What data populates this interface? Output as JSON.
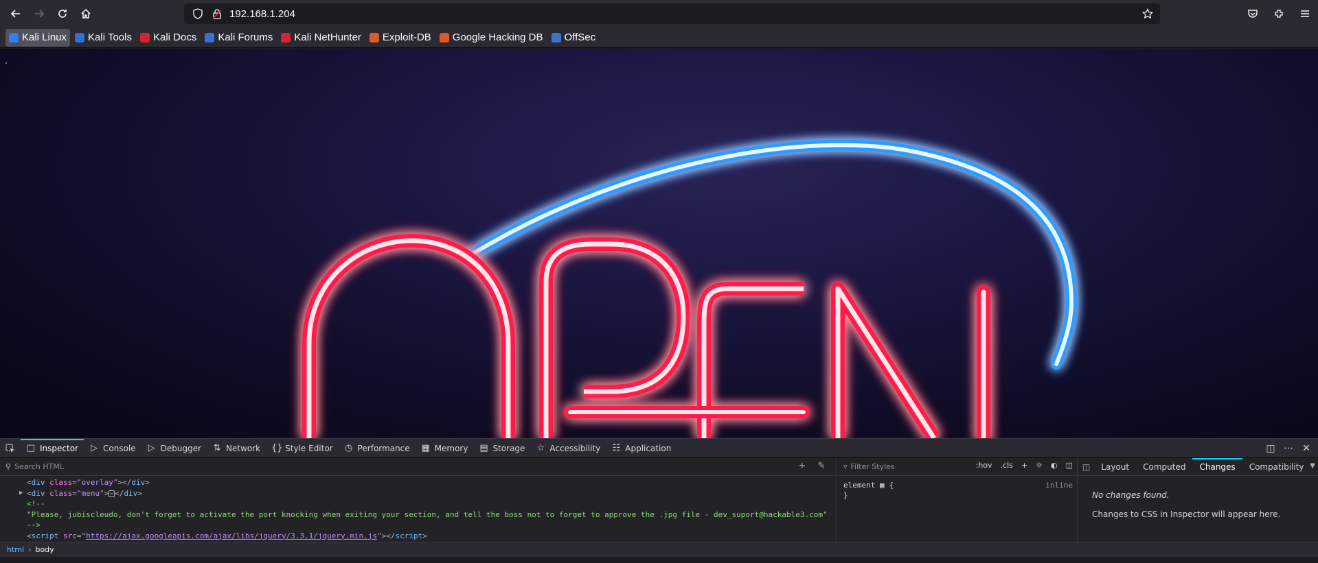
{
  "browser": {
    "url": "192.168.1.204",
    "nav": {
      "back": "back-arrow",
      "forward": "forward-arrow",
      "reload": "reload-icon",
      "home": "home-icon"
    }
  },
  "bookmarks": [
    {
      "label": "Kali Linux",
      "color": "#367bf0"
    },
    {
      "label": "Kali Tools",
      "color": "#2f6fd6"
    },
    {
      "label": "Kali Docs",
      "color": "#d6242e"
    },
    {
      "label": "Kali Forums",
      "color": "#3a6fd6"
    },
    {
      "label": "Kali NetHunter",
      "color": "#d6242e"
    },
    {
      "label": "Exploit-DB",
      "color": "#e05a28"
    },
    {
      "label": "Google Hacking DB",
      "color": "#e05a28"
    },
    {
      "label": "OffSec",
      "color": "#3f73c8"
    }
  ],
  "devtools": {
    "tabs": [
      {
        "label": "Inspector",
        "icon": "inspector-icon"
      },
      {
        "label": "Console",
        "icon": "console-icon"
      },
      {
        "label": "Debugger",
        "icon": "debugger-icon"
      },
      {
        "label": "Network",
        "icon": "network-icon"
      },
      {
        "label": "Style Editor",
        "icon": "style-editor-icon"
      },
      {
        "label": "Performance",
        "icon": "performance-icon"
      },
      {
        "label": "Memory",
        "icon": "memory-icon"
      },
      {
        "label": "Storage",
        "icon": "storage-icon"
      },
      {
        "label": "Accessibility",
        "icon": "accessibility-icon"
      },
      {
        "label": "Application",
        "icon": "application-icon"
      }
    ],
    "search_placeholder": "Search HTML",
    "code": {
      "line1_attr": "class",
      "line1_val": "\"overlay\"",
      "line2_attr": "class",
      "line2_val": "\"menu\"",
      "comment_open": "<!--",
      "comment_text": "\"Please, jubiscleudo, don't forget to activate the port knocking when exiting your section, and tell the boss not to forget to approve the .jpg file - dev_suport@hackable3.com\"",
      "comment_close": "-->",
      "script_src_attr": "src",
      "script_src": "https://ajax.googleapis.com/ajax/libs/jquery/3.3.1/jquery.min.js"
    },
    "styles": {
      "filter_placeholder": "Filter Styles",
      "hov": ":hov",
      "cls": ".cls",
      "rule_selector": "element",
      "rule_open": "{",
      "rule_close": "}",
      "inline": "inline"
    },
    "sidetabs": [
      "Layout",
      "Computed",
      "Changes",
      "Compatibility"
    ],
    "changes": {
      "none": "No changes found.",
      "hint": "Changes to CSS in Inspector will appear here."
    },
    "breadcrumb": [
      "html",
      "body"
    ]
  },
  "page": {
    "sign_text": "OPEN",
    "sign_color": "#ff2a4f",
    "arc_color": "#3aa8ff"
  }
}
